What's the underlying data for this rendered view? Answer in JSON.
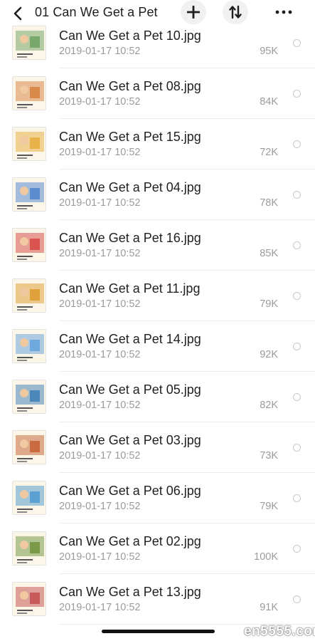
{
  "header": {
    "title": "01 Can We Get a Pet",
    "back_icon": "chevron-left-icon",
    "add_icon": "plus-icon",
    "sort_icon": "sort-arrows-icon",
    "more_icon": "more-dots-icon"
  },
  "files": [
    {
      "name": "Can We Get a Pet 10.jpg",
      "date": "2019-01-17 10:52",
      "size": "95K",
      "thumb_color": "#7aa86a"
    },
    {
      "name": "Can We Get a Pet 08.jpg",
      "date": "2019-01-17 10:52",
      "size": "84K",
      "thumb_color": "#d98a4a"
    },
    {
      "name": "Can We Get a Pet 15.jpg",
      "date": "2019-01-17 10:52",
      "size": "72K",
      "thumb_color": "#e8b24a"
    },
    {
      "name": "Can We Get a Pet 04.jpg",
      "date": "2019-01-17 10:52",
      "size": "78K",
      "thumb_color": "#5b8ccf"
    },
    {
      "name": "Can We Get a Pet 16.jpg",
      "date": "2019-01-17 10:52",
      "size": "85K",
      "thumb_color": "#d9534f"
    },
    {
      "name": "Can We Get a Pet 11.jpg",
      "date": "2019-01-17 10:52",
      "size": "79K",
      "thumb_color": "#e0a23c"
    },
    {
      "name": "Can We Get a Pet 14.jpg",
      "date": "2019-01-17 10:52",
      "size": "92K",
      "thumb_color": "#6fa8dc"
    },
    {
      "name": "Can We Get a Pet 05.jpg",
      "date": "2019-01-17 10:52",
      "size": "82K",
      "thumb_color": "#4a86b8"
    },
    {
      "name": "Can We Get a Pet 03.jpg",
      "date": "2019-01-17 10:52",
      "size": "73K",
      "thumb_color": "#c96a3f"
    },
    {
      "name": "Can We Get a Pet 06.jpg",
      "date": "2019-01-17 10:52",
      "size": "79K",
      "thumb_color": "#5aa0d0"
    },
    {
      "name": "Can We Get a Pet 02.jpg",
      "date": "2019-01-17 10:52",
      "size": "100K",
      "thumb_color": "#7a9a4a"
    },
    {
      "name": "Can We Get a Pet 13.jpg",
      "date": "2019-01-17 10:52",
      "size": "91K",
      "thumb_color": "#c85a5a"
    }
  ],
  "watermark": "en5555.com"
}
